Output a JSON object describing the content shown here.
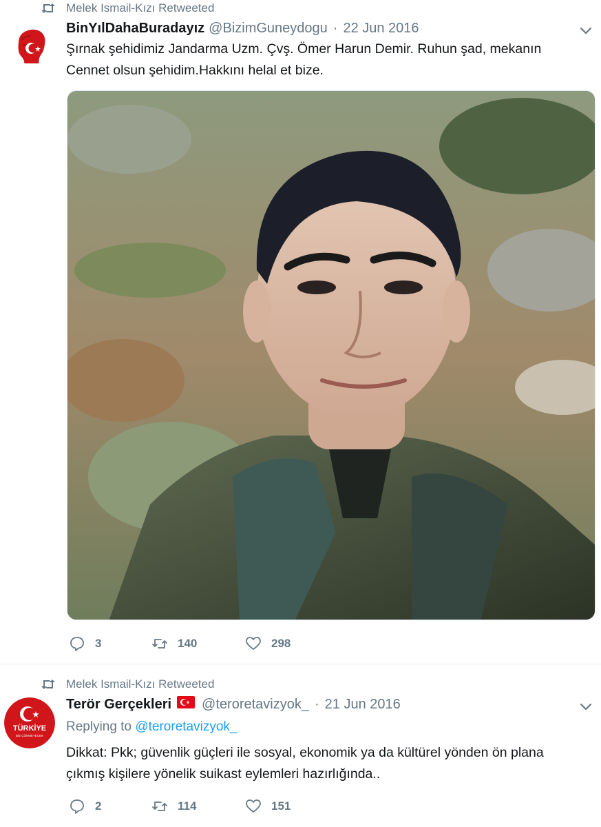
{
  "tweet1": {
    "retweeted_by": "Melek Ismail-Kızı Retweeted",
    "name": "BinYılDahaBuradayız",
    "handle": "@BizimGuneydogu",
    "separator": "·",
    "date": "22 Jun 2016",
    "text_line1": "Şırnak şehidimiz Jandarma Uzm. Çvş. Ömer Harun Demir. Ruhun şad, mekanın",
    "text_line2": "Cennet olsun şehidim.Hakkını helal et bize.",
    "replies": "3",
    "retweets": "140",
    "likes": "298"
  },
  "tweet2": {
    "retweeted_by": "Melek Ismail-Kızı Retweeted",
    "name": "Terör Gerçekleri",
    "handle": "@teroretavizyok_",
    "separator": "·",
    "date": "21 Jun 2016",
    "replying_label": "Replying to",
    "replying_handle": "@teroretavizyok_",
    "text_line1": "Dikkat: Pkk; güvenlik güçleri ile sosyal, ekonomik ya da kültürel yönden ön plana",
    "text_line2": "çıkmış kişilere yönelik suikast eylemleri hazırlığında..",
    "avatar_text1": "TÜRKİYE",
    "avatar_text2": "BİZ ÇÖKMEYECEK",
    "replies": "2",
    "retweets": "114",
    "likes": "151"
  },
  "colors": {
    "text": "#14171a",
    "secondary": "#657786",
    "link": "#1da1f2",
    "flag_red": "#e30a17",
    "avatar_red": "#d0161b"
  },
  "icons": [
    "retweet-icon",
    "chevron-down-icon",
    "reply-icon",
    "like-icon",
    "flag-icon"
  ]
}
